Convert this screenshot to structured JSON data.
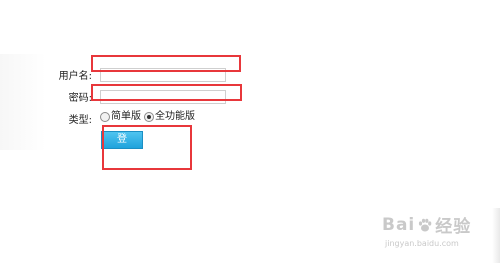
{
  "form": {
    "username_label": "用户名:",
    "password_label": "密码:",
    "type_label": "类型:",
    "username_value": "",
    "password_value": "",
    "type_options": [
      {
        "label": "简单版",
        "checked": false
      },
      {
        "label": "全功能版",
        "checked": true
      }
    ],
    "login_button": "登 陆"
  },
  "watermark": {
    "left": "Bai",
    "right": "经验",
    "sub": "jingyan.baidu.com"
  },
  "colors": {
    "highlight": "#e8373b",
    "button": "#29aee3",
    "watermark": "#c9c9c9"
  }
}
